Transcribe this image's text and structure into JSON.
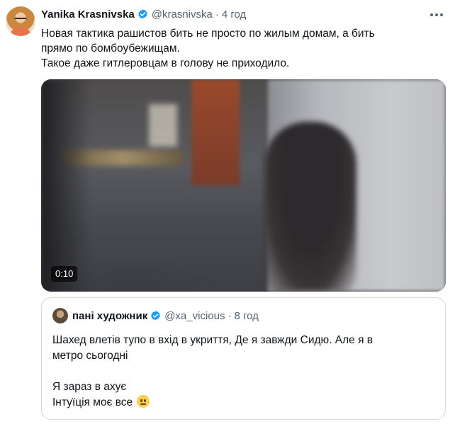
{
  "tweet": {
    "author_name": "Yanika Krasnivska",
    "handle": "@krasnivska",
    "separator": "·",
    "time": "4 год",
    "text_lines": [
      "Новая тактика рашистов бить не просто по жилым домам, а бить",
      "прямо по бомбоубежищам.",
      "Такое даже гитлеровцам в голову не приходило."
    ],
    "verified": true
  },
  "media": {
    "duration": "0:10"
  },
  "quoted_tweet": {
    "author_name": "пані художник",
    "handle": "@xa_vicious",
    "separator": "·",
    "time": "8 год",
    "text_lines": [
      "Шахед влетів тупо в вхід в укриття, Де я завжди Сидю. Але я в",
      "метро сьогодні",
      "",
      "Я зараз в ахує",
      "Інтуїція моє все"
    ],
    "trailing_emoji": "neutral-face-emoji",
    "verified": true
  },
  "colors": {
    "text": "#0f1419",
    "secondary": "#536471",
    "verified_badge": "#1d9bf0",
    "border": "#cfd9de"
  }
}
